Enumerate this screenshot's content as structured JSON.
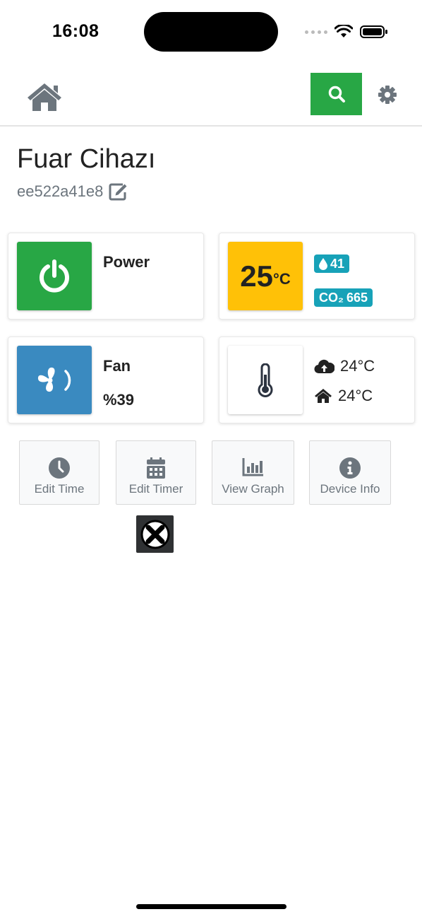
{
  "status_bar": {
    "time": "16:08"
  },
  "icons": {
    "home": "home-icon",
    "search": "search-icon",
    "settings": "gear-icon",
    "edit": "edit-icon",
    "power": "power-icon",
    "fan": "fan-icon",
    "thermometer": "thermometer-icon",
    "droplet": "droplet-icon",
    "cloud": "cloud-upload-icon",
    "house": "house-icon",
    "clock": "clock-icon",
    "calendar": "calendar-icon",
    "graph": "bar-chart-icon",
    "info": "info-icon",
    "close": "close-icon"
  },
  "colors": {
    "green": "#28a745",
    "blue": "#3a8ac0",
    "yellow": "#ffc107",
    "teal": "#17a2b8"
  },
  "device": {
    "name": "Fuar Cihazı",
    "id": "ee522a41e8"
  },
  "power_card": {
    "label": "Power"
  },
  "climate_card": {
    "temperature": "25",
    "unit": "°C",
    "humidity": "41",
    "co2_label": "CO₂",
    "co2_value": "665"
  },
  "fan_card": {
    "label": "Fan",
    "value": "%39"
  },
  "temp_card": {
    "outdoor": "24°C",
    "indoor": "24°C"
  },
  "actions": [
    {
      "label": "Edit Time"
    },
    {
      "label": "Edit Timer"
    },
    {
      "label": "View Graph"
    },
    {
      "label": "Device Info"
    }
  ]
}
